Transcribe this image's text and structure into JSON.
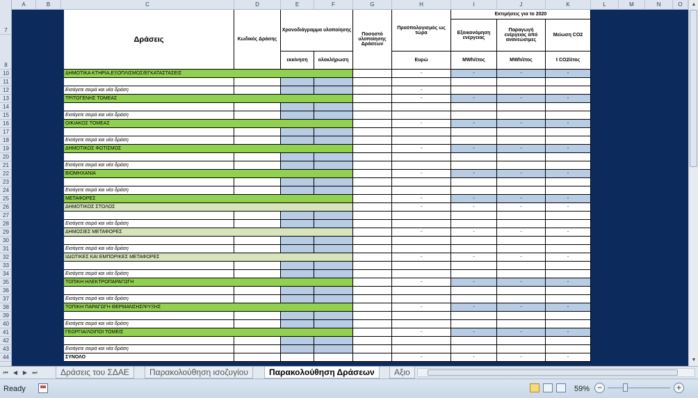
{
  "columns": [
    "A",
    "B",
    "C",
    "D",
    "E",
    "F",
    "G",
    "H",
    "I",
    "J",
    "K",
    "L",
    "M",
    "N",
    "O"
  ],
  "header": {
    "actions": "Δράσεις",
    "code": "Κωδικός Δράσης",
    "schedule": "Χρονοδιάγραμμα υλοποίησης",
    "start": "εκκίνηση",
    "end": "ολοκλήρωση",
    "percent": "Ποσοστό υλοποίησης Δράσεων",
    "budget": "Προϋπολογισμός ως τώρα",
    "budget_unit": "Ευρώ",
    "estimates": "Εκτιμήσεις για το 2020",
    "energy_saving": "Εξοικονόμηση ενέργειας",
    "energy_unit": "MWh/έτος",
    "renewable": "Παραγωγή ενέργειας από ανανεώσιμες",
    "renewable_unit": "MWh/έτος",
    "co2": "Μείωση CO2",
    "co2_unit": "t CO2/έτος"
  },
  "rows": [
    {
      "n": "10",
      "t": "cat",
      "label": "ΔΗΜΟΤΙΚΑ ΚΤΗΡΙΑ,ΕΞΟΠΛΙΣΜΟΣ/ΕΓΚΑΤΑΣΤΑΣΕΙΣ",
      "h": "-",
      "i": "-",
      "j": "-",
      "k": "-"
    },
    {
      "n": "11",
      "t": "blank"
    },
    {
      "n": "12",
      "t": "ins",
      "label": "Εισάγετε σειρά και νέα δράση",
      "h": "-"
    },
    {
      "n": "13",
      "t": "cat",
      "label": "ΤΡΙΤΟΓΕΝΗΣ ΤΟΜΕΑΣ",
      "h": "-",
      "i": "-",
      "j": "-",
      "k": "-"
    },
    {
      "n": "14",
      "t": "blank"
    },
    {
      "n": "15",
      "t": "ins",
      "label": "Εισάγετε σειρά και νέα δράση"
    },
    {
      "n": "16",
      "t": "cat",
      "label": "ΟΙΚΙΑΚΟΣ ΤΟΜΕΑΣ",
      "h": "-",
      "i": "-",
      "j": "-",
      "k": "-"
    },
    {
      "n": "17",
      "t": "blank"
    },
    {
      "n": "18",
      "t": "ins",
      "label": "Εισάγετε σειρά και νέα δράση"
    },
    {
      "n": "19",
      "t": "cat",
      "label": "ΔΗΜΟΤΙΚΟΣ ΦΩΤΙΣΜΟΣ",
      "h": "-",
      "i": "-",
      "j": "-",
      "k": "-"
    },
    {
      "n": "20",
      "t": "blank"
    },
    {
      "n": "21",
      "t": "ins",
      "label": "Εισάγετε σειρά και νέα δράση"
    },
    {
      "n": "22",
      "t": "cat",
      "label": "ΒΙΟΜΗΧΑΝΙΑ",
      "h": "-",
      "i": "-",
      "j": "-",
      "k": "-"
    },
    {
      "n": "23",
      "t": "blank"
    },
    {
      "n": "24",
      "t": "ins",
      "label": "Εισάγετε σειρά και νέα δράση"
    },
    {
      "n": "25",
      "t": "cat",
      "label": "ΜΕΤΑΦΟΡΕΣ",
      "h": "-",
      "i": "-",
      "j": "-",
      "k": "-"
    },
    {
      "n": "26",
      "t": "sub",
      "label": "ΔΗΜΟΤΙΚΟΣ ΣΤΟΛΟΣ",
      "h": "-",
      "i": "-",
      "j": "-",
      "k": "-"
    },
    {
      "n": "27",
      "t": "blank"
    },
    {
      "n": "28",
      "t": "ins",
      "label": "Εισάγετε σειρά και νέα δράση"
    },
    {
      "n": "29",
      "t": "sub",
      "label": "ΔΗΜΟΣΙΕΣ ΜΕΤΑΦΟΡΕΣ",
      "h": "-",
      "i": "-",
      "j": "-",
      "k": "-"
    },
    {
      "n": "30",
      "t": "blank"
    },
    {
      "n": "31",
      "t": "ins",
      "label": "Εισάγετε σειρά και νέα δράση"
    },
    {
      "n": "32",
      "t": "sub",
      "label": "ΙΔΙΩΤΙΚΕΣ ΚΑΙ ΕΜΠΟΡΙΚΕΣ ΜΕΤΑΦΟΡΕΣ",
      "h": "-",
      "i": "-",
      "j": "-",
      "k": "-"
    },
    {
      "n": "33",
      "t": "blank"
    },
    {
      "n": "34",
      "t": "ins",
      "label": "Εισάγετε σειρά και νέα δράση"
    },
    {
      "n": "35",
      "t": "cat",
      "label": "ΤΟΠΙΚΗ ΗΛΕΚΤΡΟΠΑΡΑΓΩΓΗ",
      "h": "-",
      "i": "-",
      "j": "-",
      "k": "-"
    },
    {
      "n": "36",
      "t": "blank"
    },
    {
      "n": "37",
      "t": "ins",
      "label": "Εισάγετε σειρά και νέα δράση"
    },
    {
      "n": "38",
      "t": "cat",
      "label": "ΤΟΠΙΚΗ ΠΑΡΑΓΩΓΗ ΘΕΡΜΑΝΣΗΣ/ΨΥΞΗΣ",
      "h": "-",
      "i": "-",
      "j": "-",
      "k": "-"
    },
    {
      "n": "39",
      "t": "blank"
    },
    {
      "n": "40",
      "t": "ins",
      "label": "Εισάγετε σειρά και νέα δράση"
    },
    {
      "n": "41",
      "t": "cat",
      "label": "ΓΕΩΡΓΙΑ/ΛΟΙΠΟΙ ΤΟΜΕΙΣ",
      "h": "-",
      "i": "-",
      "j": "-",
      "k": "-"
    },
    {
      "n": "42",
      "t": "blank"
    },
    {
      "n": "43",
      "t": "ins",
      "label": "Εισάγετε σειρά και νέα δράση"
    },
    {
      "n": "44",
      "t": "total",
      "label": "ΣΥΝΟΛΟ",
      "h": "-",
      "i": "-",
      "j": "-",
      "k": "-"
    }
  ],
  "sheet_tabs": [
    "Δράσεις του ΣΔΑΕ",
    "Παρακολούθηση ισοζυγίου",
    "Παρακολούθηση Δράσεων",
    "Αξιο"
  ],
  "active_tab": "Παρακολούθηση Δράσεων",
  "status": {
    "ready": "Ready",
    "zoom": "59%"
  },
  "colors": {
    "category": "#92d050",
    "subcategory": "#d8e4bc",
    "input": "#b8cce4",
    "frame": "#0d2a5c"
  }
}
